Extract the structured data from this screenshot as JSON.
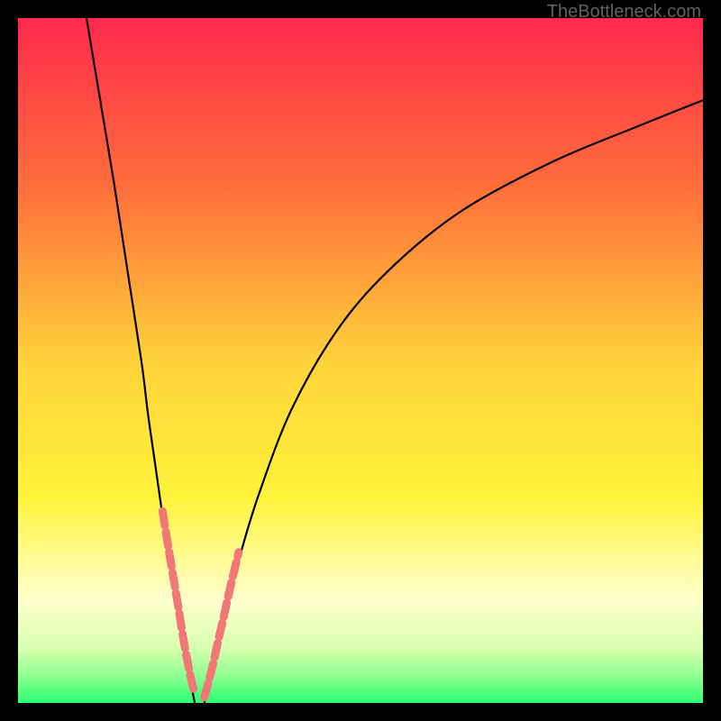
{
  "watermark": "TheBottleneck.com",
  "chart_data": {
    "type": "line",
    "title": "",
    "xlabel": "",
    "ylabel": "",
    "xlim": [
      0,
      100
    ],
    "ylim": [
      0,
      100
    ],
    "gradient_stops": [
      {
        "offset": 0.0,
        "color": "#ff2a4d"
      },
      {
        "offset": 0.25,
        "color": "#ff6f3a"
      },
      {
        "offset": 0.5,
        "color": "#ffd23a"
      },
      {
        "offset": 0.7,
        "color": "#fff33a"
      },
      {
        "offset": 0.78,
        "color": "#fffb8a"
      },
      {
        "offset": 0.85,
        "color": "#ffffcc"
      },
      {
        "offset": 0.92,
        "color": "#d8ffb0"
      },
      {
        "offset": 0.96,
        "color": "#8fff90"
      },
      {
        "offset": 1.0,
        "color": "#2cff70"
      }
    ],
    "series": [
      {
        "name": "curve-left",
        "x": [
          10,
          12,
          14,
          16,
          18,
          19,
          20,
          21,
          22,
          23,
          24,
          25,
          25.8
        ],
        "y": [
          100,
          88,
          76,
          63,
          50,
          42,
          35,
          28,
          21,
          15,
          9,
          4,
          0
        ],
        "stroke": "#000000",
        "stroke_width": 2.2
      },
      {
        "name": "curve-right",
        "x": [
          27.2,
          28,
          29,
          30,
          32,
          35,
          40,
          47,
          55,
          65,
          78,
          90,
          100
        ],
        "y": [
          0,
          3,
          7,
          12,
          20,
          30,
          43,
          55,
          64,
          72,
          79,
          84,
          88
        ],
        "stroke": "#000000",
        "stroke_width": 2.2
      },
      {
        "name": "highlight-left",
        "x": [
          21.1,
          21.9,
          22.7,
          23.4,
          24.0,
          24.6,
          25.2,
          25.8
        ],
        "y": [
          28.0,
          23.0,
          18.2,
          14.0,
          10.2,
          6.8,
          3.8,
          1.2
        ],
        "stroke": "#f27878",
        "stroke_width": 9,
        "dash": "16 7"
      },
      {
        "name": "highlight-right",
        "x": [
          27.2,
          27.9,
          28.6,
          29.2,
          29.9,
          30.6,
          31.4,
          32.2
        ],
        "y": [
          0.8,
          3.4,
          6.2,
          9.0,
          12.0,
          15.2,
          18.6,
          22.0
        ],
        "stroke": "#f27878",
        "stroke_width": 9,
        "dash": "16 7"
      }
    ],
    "note": "x and y in 0–100 relative units; y=0 is bottom (green), y=100 is top (red). Curve depicts a V-shaped bottleneck dip with minimum near x≈26."
  }
}
